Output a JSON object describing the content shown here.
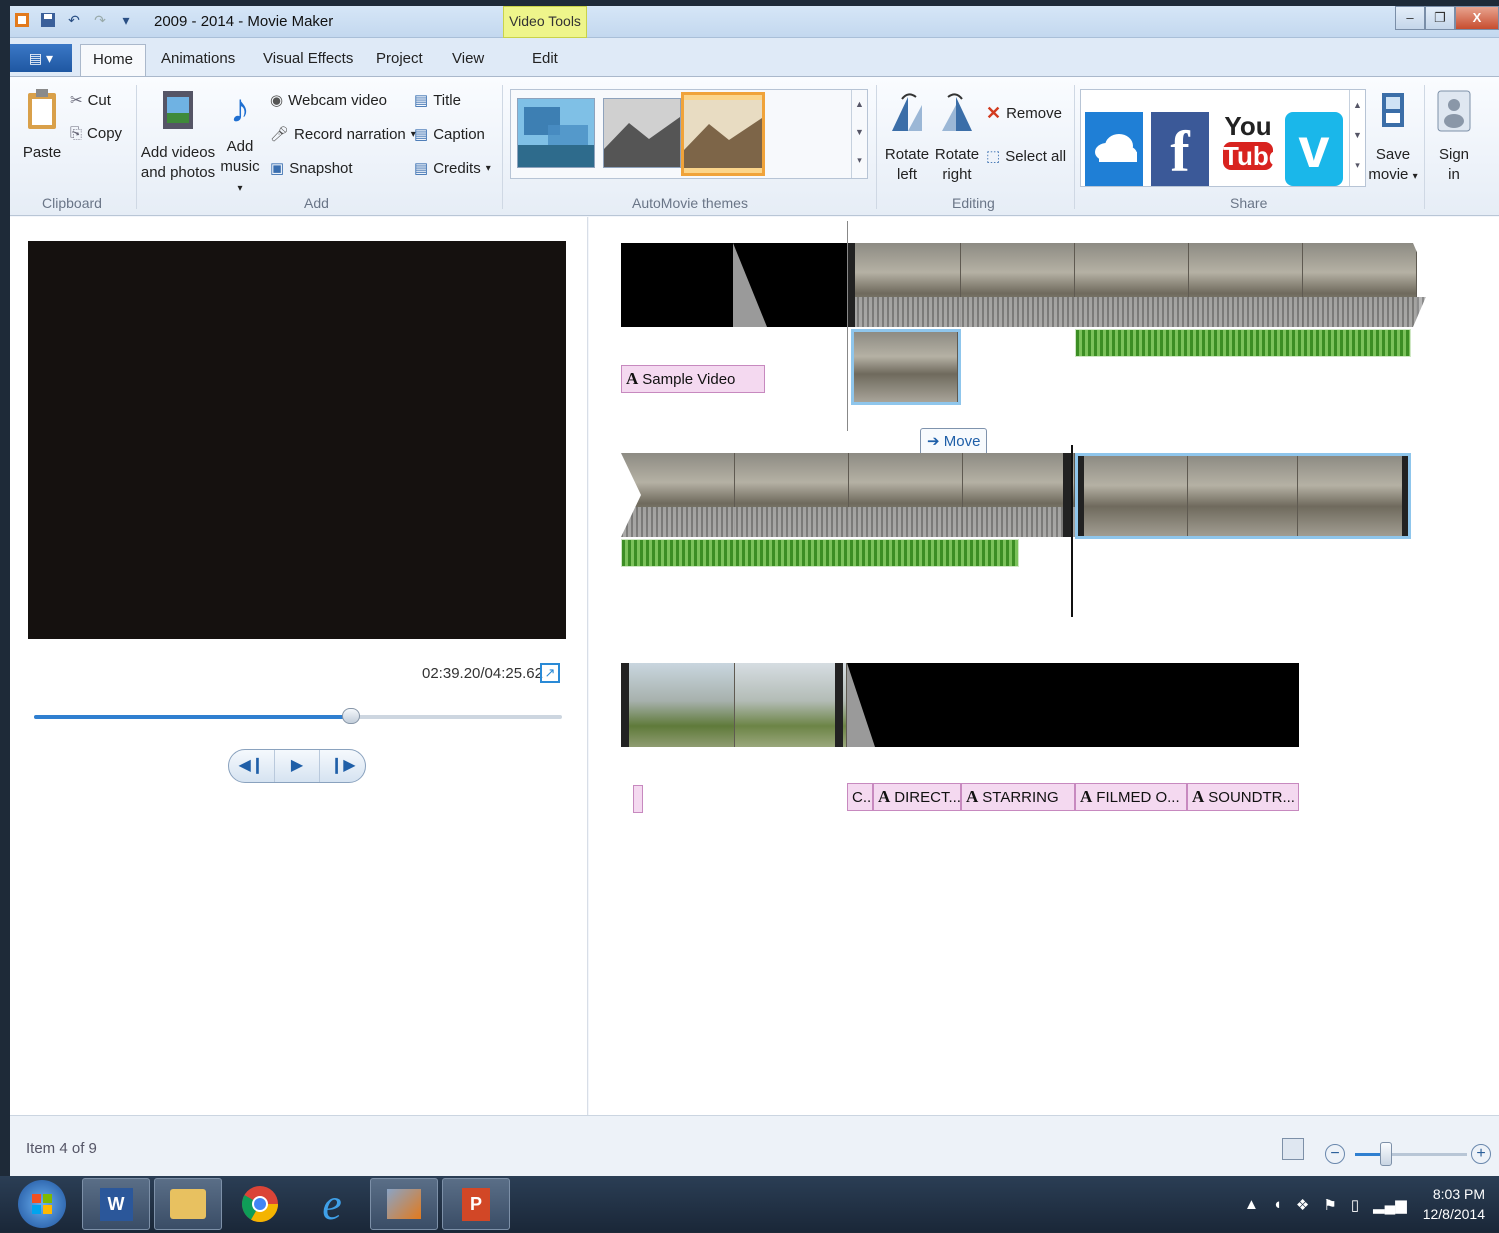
{
  "window": {
    "title": "2009 - 2014 - Movie Maker",
    "context_tab": "Video Tools"
  },
  "tabs": [
    {
      "label": "Home"
    },
    {
      "label": "Animations"
    },
    {
      "label": "Visual Effects"
    },
    {
      "label": "Project"
    },
    {
      "label": "View"
    },
    {
      "label": "Edit"
    }
  ],
  "ribbon": {
    "clipboard": {
      "group_label": "Clipboard",
      "paste": "Paste",
      "cut": "Cut",
      "copy": "Copy"
    },
    "add": {
      "group_label": "Add",
      "add_videos_line1": "Add videos",
      "add_videos_line2": "and photos",
      "add_music_line1": "Add",
      "add_music_line2": "music",
      "webcam": "Webcam video",
      "narration": "Record narration",
      "snapshot": "Snapshot",
      "title": "Title",
      "caption": "Caption",
      "credits": "Credits"
    },
    "themes": {
      "group_label": "AutoMovie themes"
    },
    "editing": {
      "group_label": "Editing",
      "rotate_left_1": "Rotate",
      "rotate_left_2": "left",
      "rotate_right_1": "Rotate",
      "rotate_right_2": "right",
      "remove": "Remove",
      "select_all": "Select all"
    },
    "share": {
      "group_label": "Share",
      "youtube_1": "You",
      "youtube_2": "Tube",
      "save_movie_1": "Save",
      "save_movie_2": "movie",
      "sign_in_1": "Sign",
      "sign_in_2": "in"
    }
  },
  "preview": {
    "timecode": "02:39.20/04:25.62",
    "progress_fraction": 0.6
  },
  "storyboard": {
    "caption_sample": "Sample Video",
    "move_tooltip": "Move",
    "credits": [
      {
        "label": "C..."
      },
      {
        "label": "DIRECT..."
      },
      {
        "label": "STARRING"
      },
      {
        "label": "FILMED O..."
      },
      {
        "label": "SOUNDTR..."
      }
    ]
  },
  "status": {
    "item_text": "Item 4 of 9",
    "zoom_fraction": 0.28
  },
  "taskbar": {
    "time": "8:03 PM",
    "date": "12/8/2014"
  },
  "colors": {
    "accent": "#2f7fd0",
    "context_tab": "#eef58b",
    "music_track": "#5ea83d",
    "caption_bg": "#f4d9f0",
    "selected_theme": "#f0a33a"
  }
}
